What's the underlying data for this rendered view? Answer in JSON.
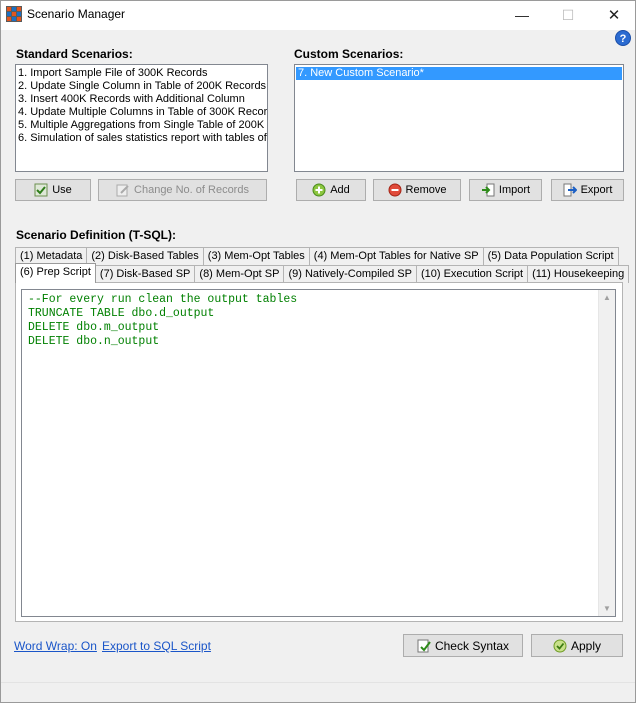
{
  "window": {
    "title": "Scenario Manager"
  },
  "standard": {
    "label": "Standard Scenarios:",
    "items": [
      "1. Import Sample File of 300K Records",
      "2. Update Single Column in Table of 200K Records",
      "3. Insert 400K Records with Additional Column",
      "4. Update Multiple Columns in Table of 300K Record",
      "5. Multiple Aggregations from Single Table of 200K R",
      "6. Simulation of sales statistics report with tables of 2("
    ],
    "use_label": "Use",
    "change_label": "Change No. of Records"
  },
  "custom": {
    "label": "Custom Scenarios:",
    "items": [
      "7. New Custom Scenario*"
    ],
    "add_label": "Add",
    "remove_label": "Remove",
    "import_label": "Import",
    "export_label": "Export"
  },
  "definition": {
    "label": "Scenario Definition (T-SQL):",
    "tabs_row1": [
      "(1) Metadata",
      "(2) Disk-Based Tables",
      "(3) Mem-Opt Tables",
      "(4) Mem-Opt Tables for Native SP",
      "(5) Data Population Script"
    ],
    "tabs_row2": [
      "(6) Prep Script",
      "(7) Disk-Based SP",
      "(8) Mem-Opt SP",
      "(9) Natively-Compiled SP",
      "(10) Execution Script",
      "(11) Housekeeping"
    ],
    "active_tab": "(6) Prep Script",
    "code": "--For every run clean the output tables\nTRUNCATE TABLE dbo.d_output\nDELETE dbo.m_output\nDELETE dbo.n_output"
  },
  "footer": {
    "word_wrap": "Word Wrap: On",
    "export_sql": "Export to SQL Script",
    "check_syntax": "Check Syntax",
    "apply": "Apply"
  }
}
